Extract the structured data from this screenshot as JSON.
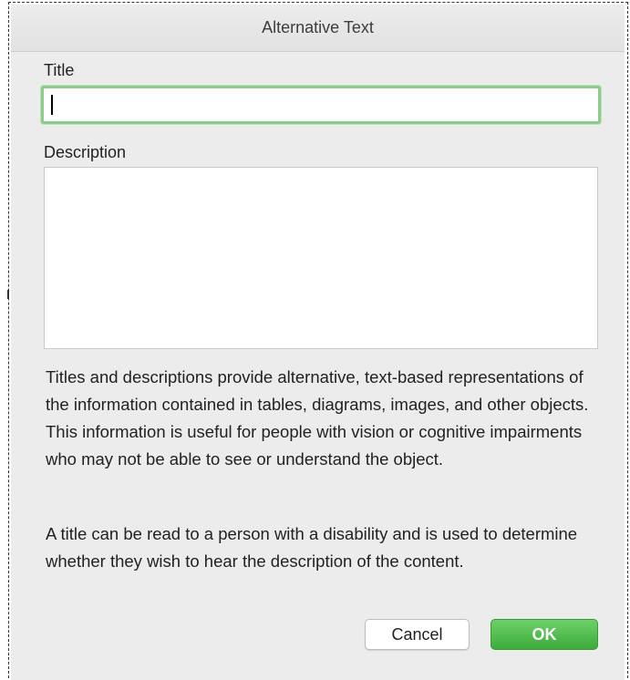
{
  "dialog": {
    "title": "Alternative Text",
    "title_label": "Title",
    "title_value": "",
    "description_label": "Description",
    "description_value": "",
    "help_paragraph_1": "Titles and descriptions provide alternative, text-based representations of the information contained in tables, diagrams, images, and other objects. This information is useful for people with vision or cognitive impairments who may not be able to see or understand the object.",
    "help_paragraph_2": "A title can be read to a person with a disability and is used to determine whether they wish to hear the description of the content.",
    "cancel_label": "Cancel",
    "ok_label": "OK"
  },
  "colors": {
    "focus_ring": "#8dcc8a",
    "ok_button": "#4cbb48",
    "dialog_bg": "#ececec"
  }
}
